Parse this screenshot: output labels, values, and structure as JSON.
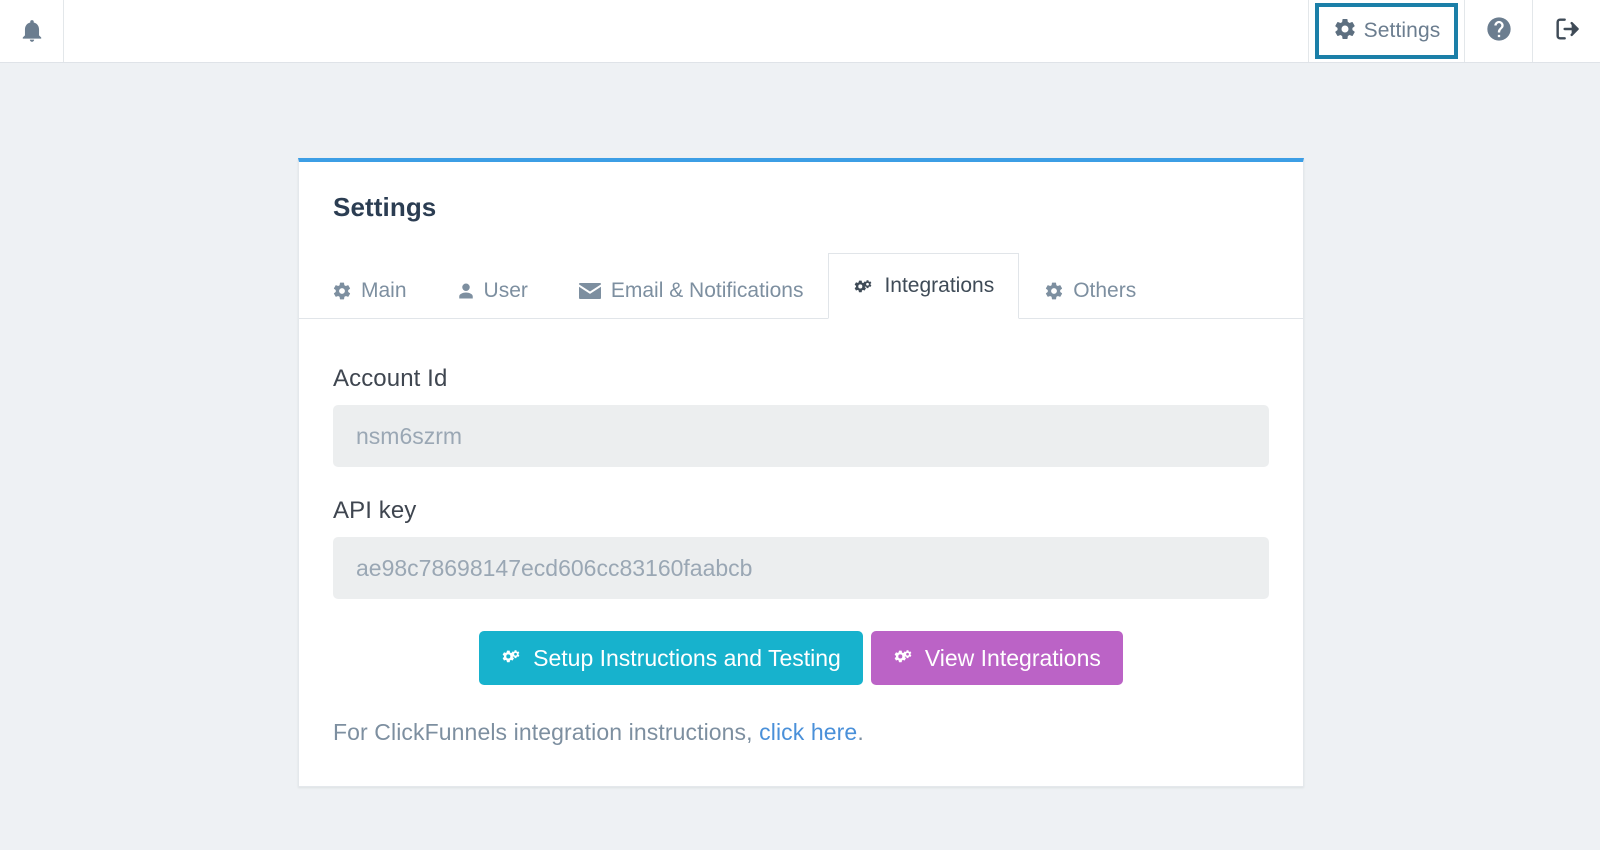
{
  "topbar": {
    "bell_icon": "bell-icon",
    "settings_button": {
      "label": "Settings",
      "icon": "gear-icon",
      "highlight_color": "#1b7fa8"
    },
    "help_icon": "question-circle-icon",
    "logout_icon": "sign-out-icon"
  },
  "card": {
    "title": "Settings",
    "accent_color": "#3c9ee5",
    "tabs": [
      {
        "label": "Main",
        "icon": "gear-icon",
        "active": false
      },
      {
        "label": "User",
        "icon": "user-icon",
        "active": false
      },
      {
        "label": "Email & Notifications",
        "icon": "envelope-icon",
        "active": false
      },
      {
        "label": "Integrations",
        "icon": "cogs-icon",
        "active": true
      },
      {
        "label": "Others",
        "icon": "gear-icon",
        "active": false
      }
    ],
    "fields": [
      {
        "label": "Account Id",
        "value": "nsm6szrm",
        "placeholder": "nsm6szrm"
      },
      {
        "label": "API key",
        "value": "ae98c78698147ecd606cc83160faabcb",
        "placeholder": "ae98c78698147ecd606cc83160faabcb"
      }
    ],
    "buttons": [
      {
        "label": "Setup Instructions and Testing",
        "icon": "cogs-icon",
        "color": "#17b2cd"
      },
      {
        "label": "View Integrations",
        "icon": "cogs-icon",
        "color": "#bb63c6"
      }
    ],
    "footer": {
      "text_before": "For ClickFunnels integration instructions,",
      "link_text": "click here",
      "text_after": "."
    }
  }
}
